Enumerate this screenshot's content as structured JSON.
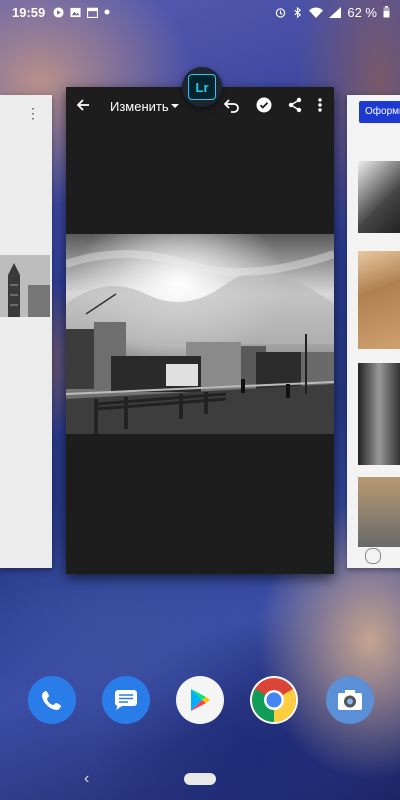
{
  "status_bar": {
    "time": "19:59",
    "battery_text": "62 %",
    "icons_left": [
      "media-icon",
      "image-icon",
      "calendar-icon",
      "dot-icon"
    ],
    "icons_right": [
      "alarm-icon",
      "bluetooth-icon",
      "wifi-icon",
      "signal-icon",
      "battery-icon"
    ]
  },
  "recents": {
    "current_app": {
      "badge_label": "Lr",
      "toolbar_title": "Изменить",
      "toolbar_icons": [
        "back-arrow-icon",
        "dropdown-caret-icon",
        "undo-icon",
        "checkmark-icon",
        "share-icon",
        "overflow-menu-icon"
      ]
    },
    "right_card": {
      "button_label": "Оформит"
    }
  },
  "dock": {
    "apps": [
      "phone",
      "messages",
      "play-store",
      "chrome",
      "camera"
    ]
  },
  "colors": {
    "lr_accent": "#31c5f0",
    "card_dark": "#1d1d1d",
    "button_blue": "#1d39d1",
    "phone_blue": "#2a7ce8"
  }
}
